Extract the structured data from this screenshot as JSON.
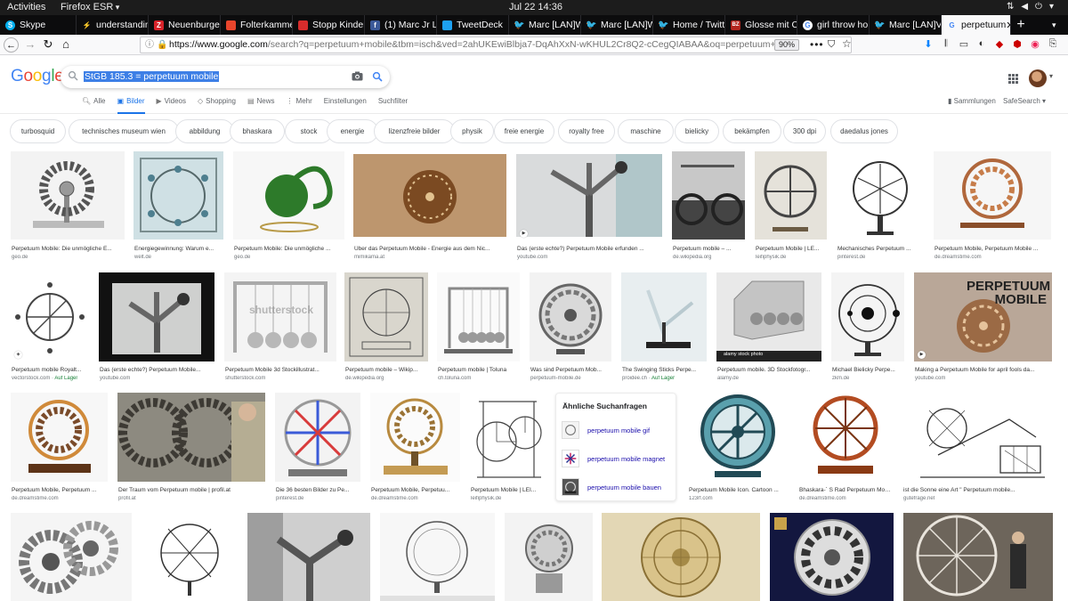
{
  "system_bar": {
    "activities": "Activities",
    "app": "Firefox ESR",
    "clock": "Jul 22  14:36"
  },
  "tabs": [
    {
      "label": "Skype",
      "icon": "skype-icon",
      "color": "#00aff0"
    },
    {
      "label": "understandin",
      "icon": "bolt-icon",
      "color": "#5a5a5a"
    },
    {
      "label": "Neuenburge",
      "icon": "zeit-icon",
      "color": "#d8232a"
    },
    {
      "label": "Folterkamme",
      "icon": "folder-icon",
      "color": "#e8452c"
    },
    {
      "label": "Stopp Kinder",
      "icon": "campaign-icon",
      "color": "#d72c2c"
    },
    {
      "label": "(1) Marc Jr La",
      "icon": "facebook-icon",
      "color": "#3b5998"
    },
    {
      "label": "TweetDeck",
      "icon": "tweetdeck-icon",
      "color": "#1da1f2"
    },
    {
      "label": "Marc [LAN]W",
      "icon": "twitter-icon",
      "color": "#1da1f2"
    },
    {
      "label": "Marc [LAN]W",
      "icon": "twitter-icon",
      "color": "#1da1f2"
    },
    {
      "label": "Home / Twitt",
      "icon": "twitter-icon",
      "color": "#1da1f2"
    },
    {
      "label": "Glosse mit C",
      "icon": "bz-icon",
      "color": "#b3261e"
    },
    {
      "label": "girl throw ho",
      "icon": "google-icon",
      "color": "#4285f4"
    },
    {
      "label": "Marc [LAN]V",
      "icon": "twitter-icon",
      "color": "#1da1f2"
    },
    {
      "label": "perpetuum",
      "icon": "google-icon",
      "color": "#4285f4",
      "active": true
    }
  ],
  "nav": {
    "url_host": "https://www.google.com",
    "url_path": "/search?q=perpetuum+mobile&tbm=isch&ved=2ahUKEwiBlbja7-DqAhXxN-wKHUL2Cr8Q2-cCegQIABAA&oq=perpetuum+mobile&gs",
    "zoom": "90%"
  },
  "google": {
    "logo_letters": [
      "G",
      "o",
      "o",
      "g",
      "l",
      "e"
    ],
    "query": "StGB 185.3 = perpetuum mobile",
    "tabs": [
      {
        "label": "Alle",
        "icon": "search-icon"
      },
      {
        "label": "Bilder",
        "icon": "image-icon",
        "active": true
      },
      {
        "label": "Videos",
        "icon": "video-icon"
      },
      {
        "label": "Shopping",
        "icon": "tag-icon"
      },
      {
        "label": "News",
        "icon": "news-icon"
      },
      {
        "label": "Mehr",
        "icon": "more-icon"
      }
    ],
    "settings": "Einstellungen",
    "search_filter": "Suchfilter",
    "collections": "Sammlungen",
    "safesearch": "SafeSearch"
  },
  "chips": [
    "turbosquid",
    "technisches museum wien",
    "abbildung",
    "bhaskara",
    "stock",
    "energie",
    "lizenzfreie bilder",
    "physik",
    "freie energie",
    "royalty free",
    "maschine",
    "bielicky",
    "bekämpfen",
    "300 dpi",
    "daedalus jones"
  ],
  "rows": [
    [
      {
        "caption": "Perpetuum Mobile: Die unmögliche E...",
        "source": "geo.de"
      },
      {
        "caption": "Energiegewinnung: Warum e...",
        "source": "welt.de"
      },
      {
        "caption": "Perpetuum Mobile: Die unmögliche ...",
        "source": "geo.de"
      },
      {
        "caption": "Über das Perpetuum Mobile - Energie aus dem Nic...",
        "source": "mimikama.at"
      },
      {
        "caption": "Das (erste echte?) Perpetuum Mobile erfunden ...",
        "source": "youtube.com"
      },
      {
        "caption": "Perpetuum mobile – ...",
        "source": "de.wikipedia.org"
      },
      {
        "caption": "Perpetuum Mobile | LE...",
        "source": "leifiphysik.de"
      },
      {
        "caption": "Mechanisches Perpetuum ...",
        "source": "pinterest.de"
      },
      {
        "caption": "Perpetuum Mobile, Perpetuum Mobile ...",
        "source": "de.dreamstime.com"
      }
    ],
    [
      {
        "caption": "Perpetuum mobile Royalt...",
        "source": "vectorstock.com",
        "extra": "Auf Lager"
      },
      {
        "caption": "Das (erste echte?) Perpetuum Mobile...",
        "source": "youtube.com"
      },
      {
        "caption": "Perpetuum Mobile 3d Stockillustrat...",
        "source": "shutterstock.com"
      },
      {
        "caption": "Perpetuum mobile – Wikip...",
        "source": "de.wikipedia.org"
      },
      {
        "caption": "Perpetuum mobile | Toluna",
        "source": "ch.toluna.com"
      },
      {
        "caption": "Was sind Perpetuum Mob...",
        "source": "perpetuum-mobile.de"
      },
      {
        "caption": "The Swinging Sticks Perpe...",
        "source": "proidee.ch",
        "extra": "Auf Lager"
      },
      {
        "caption": "Perpetuum mobile. 3D Stockfotogr...",
        "source": "alamy.de"
      },
      {
        "caption": "Michael Bielicky Perpe...",
        "source": "zkm.de"
      },
      {
        "caption": "Making a Perpetuum Mobile for april fools da...",
        "source": "youtube.com"
      }
    ],
    [
      {
        "caption": "Perpetuum Mobile, Perpetuum ...",
        "source": "de.dreamstime.com"
      },
      {
        "caption": "Der Traum vom Perpetuum mobile | profil.at",
        "source": "profil.at"
      },
      {
        "caption": "Die 36 besten Bilder zu Pe...",
        "source": "pinterest.de"
      },
      {
        "caption": "Perpetuum Mobile, Perpetuu...",
        "source": "de.dreamstime.com"
      },
      {
        "caption": "Perpetuum Mobile | LEI...",
        "source": "leifiphysik.de"
      },
      {
        "caption": "Perpetuum Mobile Icon. Cartoon ...",
        "source": "123rf.com"
      },
      {
        "caption": "Bhaskara-´ S Rad Perpetuum Mobile P...",
        "source": "de.dreamstime.com"
      },
      {
        "caption": "ist die Sonne eine Art \" Perpetuum mobile...",
        "source": "gutefrage.net"
      }
    ]
  ],
  "watermarks": {
    "shutterstock": "shutterstock",
    "alamy": "alamy stock photo",
    "pm_title": "PERPETUUM MOBILE"
  },
  "related": {
    "title": "Ähnliche Suchanfragen",
    "items": [
      "perpetuum mobile gif",
      "perpetuum mobile magnet",
      "perpetuum mobile bauen"
    ]
  }
}
